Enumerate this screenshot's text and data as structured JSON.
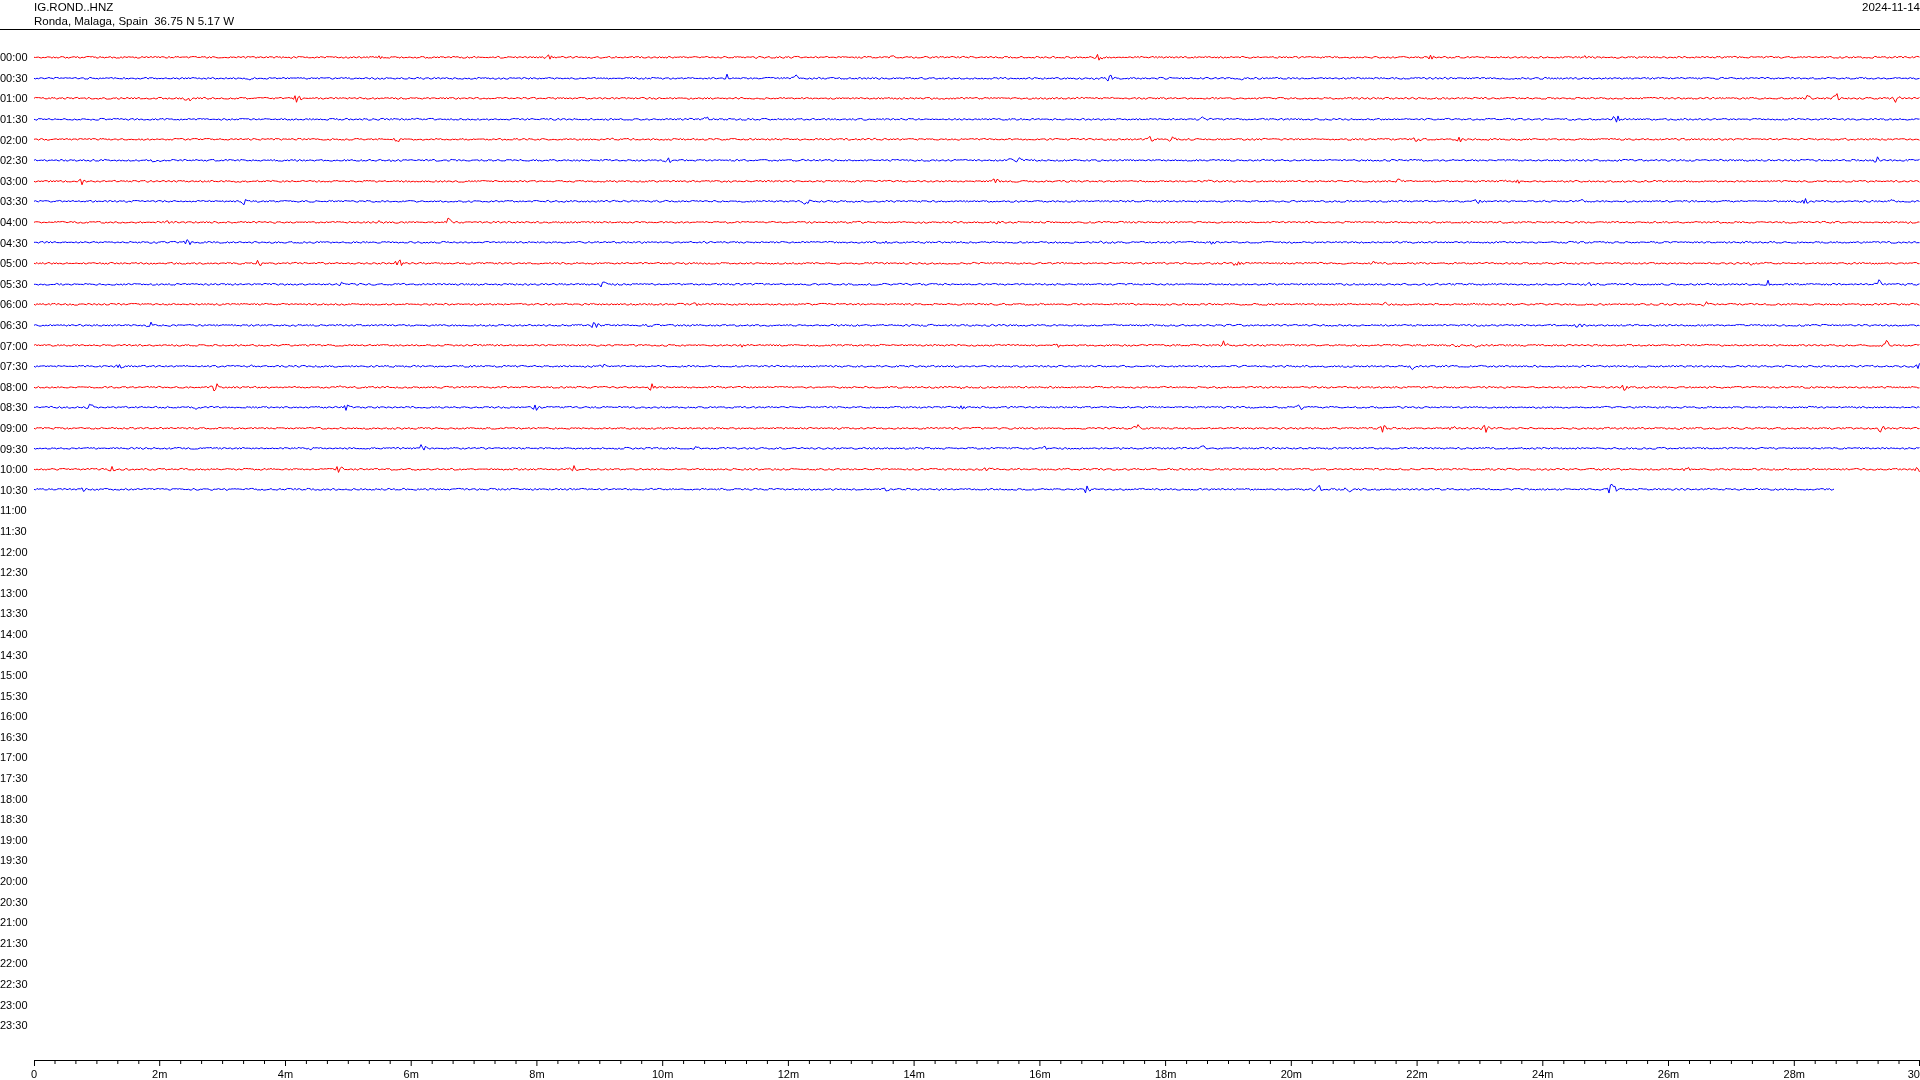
{
  "header": {
    "station": "IG.ROND..HNZ",
    "location": "Ronda, Malaga, Spain  36.75 N 5.17 W",
    "date": "2024-11-14"
  },
  "rows": [
    {
      "time": "00:00",
      "kind": "full",
      "color": "#ff0000"
    },
    {
      "time": "00:30",
      "kind": "full",
      "color": "#0000ff"
    },
    {
      "time": "01:00",
      "kind": "full",
      "color": "#ff0000"
    },
    {
      "time": "01:30",
      "kind": "full",
      "color": "#0000ff"
    },
    {
      "time": "02:00",
      "kind": "full",
      "color": "#ff0000"
    },
    {
      "time": "02:30",
      "kind": "full",
      "color": "#0000ff"
    },
    {
      "time": "03:00",
      "kind": "full",
      "color": "#ff0000"
    },
    {
      "time": "03:30",
      "kind": "full",
      "color": "#0000ff"
    },
    {
      "time": "04:00",
      "kind": "full",
      "color": "#ff0000"
    },
    {
      "time": "04:30",
      "kind": "full",
      "color": "#0000ff"
    },
    {
      "time": "05:00",
      "kind": "full",
      "color": "#ff0000"
    },
    {
      "time": "05:30",
      "kind": "full",
      "color": "#0000ff"
    },
    {
      "time": "06:00",
      "kind": "full",
      "color": "#ff0000"
    },
    {
      "time": "06:30",
      "kind": "full",
      "color": "#0000ff"
    },
    {
      "time": "07:00",
      "kind": "full",
      "color": "#ff0000"
    },
    {
      "time": "07:30",
      "kind": "full",
      "color": "#0000ff"
    },
    {
      "time": "08:00",
      "kind": "full",
      "color": "#ff0000"
    },
    {
      "time": "08:30",
      "kind": "full",
      "color": "#0000ff"
    },
    {
      "time": "09:00",
      "kind": "full",
      "color": "#ff0000"
    },
    {
      "time": "09:30",
      "kind": "full",
      "color": "#0000ff"
    },
    {
      "time": "10:00",
      "kind": "full",
      "color": "#ff0000"
    },
    {
      "time": "10:30",
      "kind": "partial",
      "color": "#0000ff"
    },
    {
      "time": "11:00",
      "kind": "none"
    },
    {
      "time": "11:30",
      "kind": "none"
    },
    {
      "time": "12:00",
      "kind": "none"
    },
    {
      "time": "12:30",
      "kind": "none"
    },
    {
      "time": "13:00",
      "kind": "none"
    },
    {
      "time": "13:30",
      "kind": "none"
    },
    {
      "time": "14:00",
      "kind": "none"
    },
    {
      "time": "14:30",
      "kind": "none"
    },
    {
      "time": "15:00",
      "kind": "none"
    },
    {
      "time": "15:30",
      "kind": "none"
    },
    {
      "time": "16:00",
      "kind": "none"
    },
    {
      "time": "16:30",
      "kind": "none"
    },
    {
      "time": "17:00",
      "kind": "none"
    },
    {
      "time": "17:30",
      "kind": "none"
    },
    {
      "time": "18:00",
      "kind": "none"
    },
    {
      "time": "18:30",
      "kind": "none"
    },
    {
      "time": "19:00",
      "kind": "none"
    },
    {
      "time": "19:30",
      "kind": "none"
    },
    {
      "time": "20:00",
      "kind": "none"
    },
    {
      "time": "20:30",
      "kind": "none"
    },
    {
      "time": "21:00",
      "kind": "none"
    },
    {
      "time": "21:30",
      "kind": "none"
    },
    {
      "time": "22:00",
      "kind": "none"
    },
    {
      "time": "22:30",
      "kind": "none"
    },
    {
      "time": "23:00",
      "kind": "none"
    },
    {
      "time": "23:30",
      "kind": "none"
    }
  ],
  "axis": {
    "labels": [
      "0",
      "2m",
      "4m",
      "6m",
      "8m",
      "10m",
      "12m",
      "14m",
      "16m",
      "18m",
      "20m",
      "22m",
      "24m",
      "26m",
      "28m",
      "30"
    ]
  }
}
